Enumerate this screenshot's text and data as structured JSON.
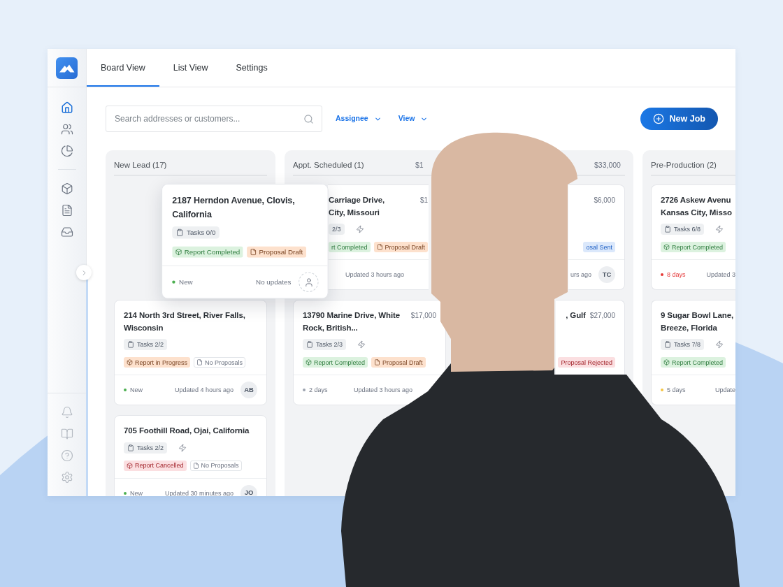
{
  "sidebar": {
    "nav_top": [
      {
        "selected": true
      },
      {
        "selected": false
      },
      {
        "selected": false
      }
    ],
    "nav_middle": [
      {
        "selected": false
      },
      {
        "selected": false
      },
      {
        "selected": false
      }
    ],
    "nav_bottom": [
      {
        "selected": false
      },
      {
        "selected": false
      },
      {
        "selected": false
      },
      {
        "selected": false
      }
    ]
  },
  "tabs": [
    {
      "label": "Board View",
      "selected": true
    },
    {
      "label": "List View",
      "selected": false
    },
    {
      "label": "Settings",
      "selected": false
    }
  ],
  "toolbar": {
    "search": {
      "placeholder": "Search addresses or customers..."
    },
    "filters": [
      "Assignee",
      "View"
    ],
    "primary_button": "New Job"
  },
  "board": {
    "columns": [
      {
        "kind": "whole",
        "title": "New Lead (17)",
        "cards": [
          {
            "kind": "dragged",
            "title": "2187 Herndon Avenue, Clovis, California",
            "tasks": "Tasks 0/0",
            "bolt": false,
            "tags": [
              {
                "kind": "report",
                "label": "Report Completed",
                "color": "#dcf2df"
              },
              {
                "kind": "proposal",
                "label": "Proposal Draft",
                "color": "#fde1cd"
              }
            ],
            "status": {
              "label": "New",
              "color": "#4caf50",
              "overdue": false
            },
            "updated": "No updates",
            "avatar": {
              "kind": "empty"
            }
          },
          {
            "kind": "whole",
            "title": "214 North 3rd Street, River Falls, Wisconsin",
            "tasks": "Tasks 2/2",
            "bolt": false,
            "tags": [
              {
                "kind": "report",
                "label": "Report in Progress",
                "color": "#fde1cd"
              },
              {
                "kind": "proposal",
                "label": "No Proposals",
                "color": "#ffffff"
              }
            ],
            "status": {
              "label": "New",
              "color": "#4caf50",
              "overdue": false
            },
            "updated": "Updated 4 hours ago",
            "avatar": {
              "kind": "initials",
              "text": "AB"
            }
          },
          {
            "kind": "whole",
            "title": "705 Foothill Road, Ojai, California",
            "tasks": "Tasks 2/2",
            "bolt": true,
            "tags": [
              {
                "kind": "report",
                "label": "Report Cancelled",
                "color": "#fbdfe1"
              },
              {
                "kind": "proposal",
                "label": "No Proposals",
                "color": "#ffffff"
              }
            ],
            "status": {
              "label": "New",
              "color": "#4caf50",
              "overdue": false
            },
            "updated": "Updated 30 minutes ago",
            "avatar": {
              "kind": "initials",
              "text": "JO"
            }
          }
        ]
      },
      {
        "kind": "whole",
        "title": "Appt. Scheduled (1)",
        "amount": "$1",
        "cards": [
          {
            "kind": "middle",
            "title_lines": [
              "Carriage Drive,",
              "City, Missouri"
            ],
            "price": "$1",
            "tasks": "2/3",
            "bolt": true,
            "tags": [
              {
                "label": "rt Completed",
                "color": "#dcf2df"
              },
              {
                "kind": "proposal",
                "label": "Proposal Draft",
                "color": "#fde1cd"
              }
            ],
            "updated": "Updated 3 hours ago"
          },
          {
            "kind": "whole",
            "title": "13790 Marine Drive, White Rock, British...",
            "price": "$17,000",
            "tasks": "Tasks 2/3",
            "bolt": true,
            "tags": [
              {
                "kind": "report",
                "label": "Report Completed",
                "color": "#dcf2df"
              },
              {
                "kind": "proposal",
                "label": "Proposal Draft",
                "color": "#fde1cd"
              }
            ],
            "status": {
              "label": "2 days",
              "color": "#9ca3af",
              "overdue": false
            },
            "updated": "Updated 3 hours ago"
          }
        ]
      },
      {
        "kind": "whole",
        "amount": "$33,000",
        "cards": [
          {
            "kind": "rightpart",
            "price": "$6,000",
            "tags": [
              {
                "label": "osal Sent",
                "color": "#dbe8fb"
              }
            ],
            "updated": "urs ago",
            "avatar": {
              "kind": "initials",
              "text": "TC"
            }
          },
          {
            "kind": "corner",
            "title_lines": [
              ", Gulf"
            ],
            "price": "$27,000",
            "tags": [
              {
                "label": "Proposal Rejected",
                "color": "#fbdfe1"
              }
            ]
          }
        ]
      },
      {
        "kind": "leftpart",
        "title": "Pre-Production (2)",
        "cards": [
          {
            "kind": "leftpart",
            "title_lines": [
              "2726 Askew Avenu",
              "Kansas City, Misso"
            ],
            "tasks": "Tasks 6/8",
            "bolt": true,
            "tags": [
              {
                "kind": "report",
                "label": "Report Completed",
                "color": "#dcf2df"
              }
            ],
            "status": {
              "label": "8 days",
              "color": "#e53935",
              "overdue": true
            },
            "updated": "Updated 3"
          },
          {
            "kind": "leftpart",
            "title_lines": [
              "9 Sugar Bowl Lane,",
              "Breeze, Florida"
            ],
            "tasks": "Tasks 7/8",
            "bolt": true,
            "tags": [
              {
                "kind": "report",
                "label": "Report Completed",
                "color": "#dcf2df"
              }
            ],
            "status": {
              "label": "5 days",
              "color": "#f5c542",
              "overdue": false
            },
            "updated": "Update"
          }
        ]
      }
    ]
  }
}
